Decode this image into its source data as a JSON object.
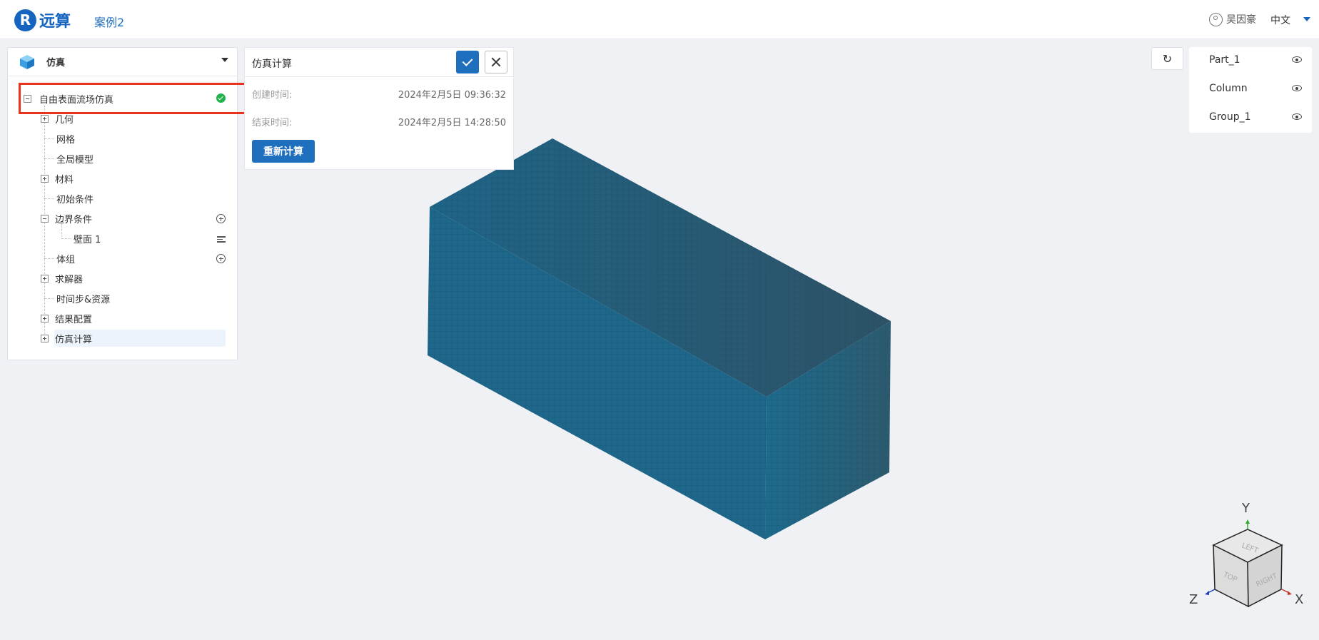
{
  "header": {
    "logo_mark": "R",
    "brand": "远算",
    "case_name": "案例2",
    "user_name": "吴因豪",
    "language": "中文"
  },
  "left_panel": {
    "title": "仿真",
    "tree": {
      "root": "自由表面流场仿真",
      "items": [
        {
          "label": "几何"
        },
        {
          "label": "网格"
        },
        {
          "label": "全局模型"
        },
        {
          "label": "材料"
        },
        {
          "label": "初始条件"
        },
        {
          "label": "边界条件"
        },
        {
          "label": "壁面 1"
        },
        {
          "label": "体组"
        },
        {
          "label": "求解器"
        },
        {
          "label": "时间步&资源"
        },
        {
          "label": "结果配置"
        },
        {
          "label": "仿真计算"
        }
      ]
    }
  },
  "sim_panel": {
    "title": "仿真计算",
    "created_label": "创建时间:",
    "created_value": "2024年2月5日 09:36:32",
    "ended_label": "结束时间:",
    "ended_value": "2024年2月5日 14:28:50",
    "recompute_label": "重新计算"
  },
  "viewport": {
    "reset_icon": "↻",
    "parts": [
      {
        "label": "Part_1"
      },
      {
        "label": "Column"
      },
      {
        "label": "Group_1"
      }
    ],
    "axes": {
      "x": "X",
      "y": "Y",
      "z": "Z"
    },
    "cube_faces": {
      "left": "LEFT",
      "top": "TOP",
      "right": "RIGHT"
    }
  },
  "colors": {
    "accent": "#1f6fbf",
    "mesh": "#1e5f80",
    "status_ok": "#21b24b",
    "highlight_border": "#e8341c"
  }
}
